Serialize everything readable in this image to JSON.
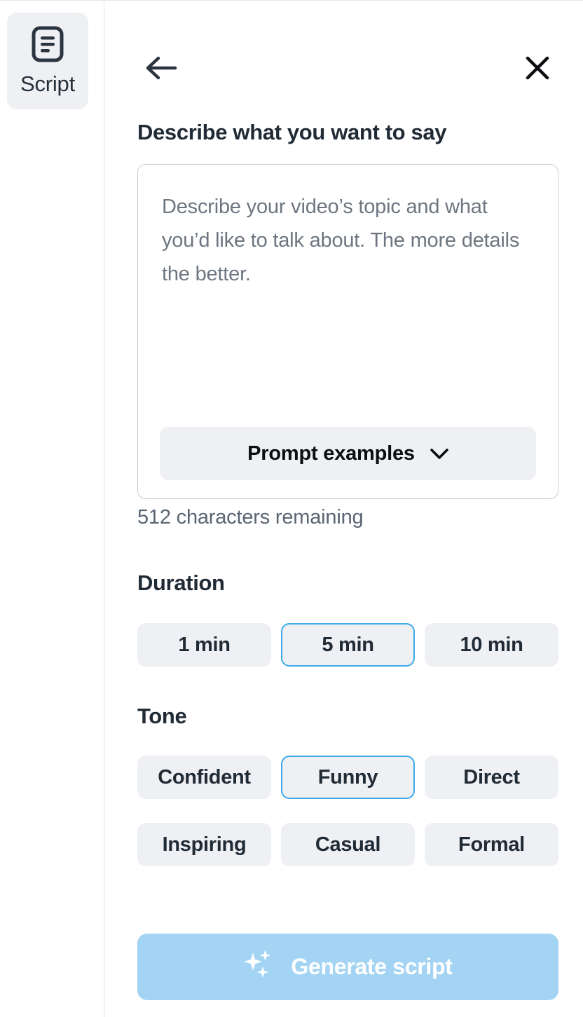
{
  "sidebar": {
    "items": [
      {
        "id": "script",
        "label": "Script",
        "icon": "script-document-icon",
        "active": true
      }
    ]
  },
  "header": {
    "back_icon": "arrow-left-icon",
    "close_icon": "close-x-icon"
  },
  "main": {
    "title": "Describe what you want to say",
    "prompt": {
      "value": "",
      "placeholder": "Describe your video’s topic and what you’d like to talk about. The more details the better.",
      "examples_label": "Prompt examples",
      "examples_icon": "chevron-down-icon",
      "char_count_text": "512 characters remaining"
    },
    "duration": {
      "title": "Duration",
      "options": [
        {
          "label": "1 min",
          "selected": false
        },
        {
          "label": "5 min",
          "selected": true
        },
        {
          "label": "10 min",
          "selected": false
        }
      ]
    },
    "tone": {
      "title": "Tone",
      "options": [
        {
          "label": "Confident",
          "selected": false
        },
        {
          "label": "Funny",
          "selected": true
        },
        {
          "label": "Direct",
          "selected": false
        },
        {
          "label": "Inspiring",
          "selected": false
        },
        {
          "label": "Casual",
          "selected": false
        },
        {
          "label": "Formal",
          "selected": false
        }
      ]
    },
    "generate": {
      "label": "Generate script",
      "icon": "sparkles-icon",
      "disabled": true
    }
  },
  "colors": {
    "accent_blue": "#3fa9e8",
    "button_disabled_blue": "#a4d4f4",
    "pill_bg": "#eef0f3",
    "text_primary": "#212b36",
    "text_muted": "#5a6573",
    "placeholder": "#6d7680",
    "border": "#c8ced6"
  }
}
